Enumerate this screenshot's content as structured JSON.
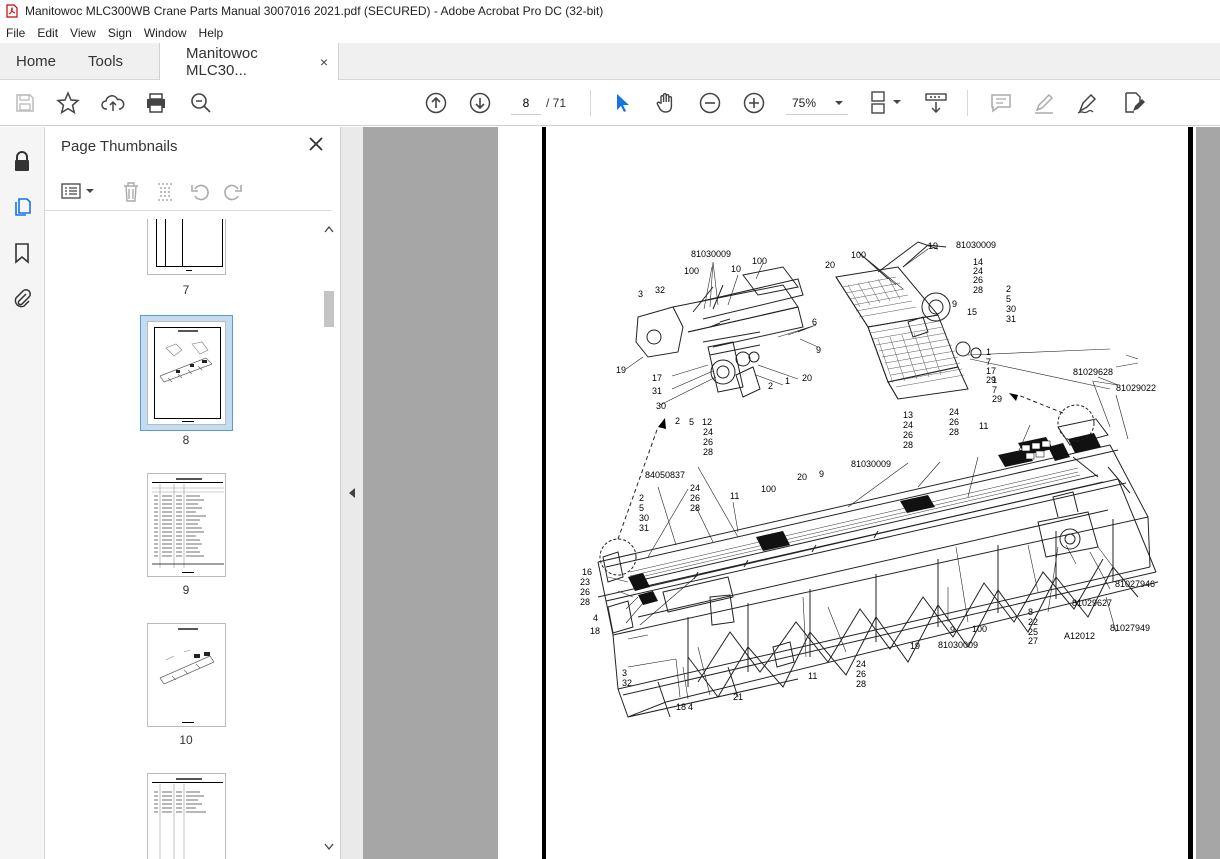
{
  "window": {
    "title": "Manitowoc MLC300WB Crane Parts Manual 3007016 2021.pdf (SECURED) - Adobe Acrobat Pro DC (32-bit)"
  },
  "menu": [
    "File",
    "Edit",
    "View",
    "Sign",
    "Window",
    "Help"
  ],
  "tabs": {
    "home": "Home",
    "tools": "Tools",
    "doc": "Manitowoc MLC30...",
    "doc_close": "×"
  },
  "toolbar": {
    "page_current": "8",
    "page_total": "/ 71",
    "zoom": "75%"
  },
  "panel": {
    "title": "Page Thumbnails"
  },
  "thumbnails": [
    {
      "label": "7"
    },
    {
      "label": "8",
      "selected": true
    },
    {
      "label": "9"
    },
    {
      "label": "10"
    }
  ],
  "callouts": {
    "top_left": [
      "81030009",
      "100",
      "10",
      "100",
      "3",
      "32",
      "6",
      "9",
      "19",
      "17",
      "31",
      "30",
      "2",
      "5",
      "12",
      "24",
      "26",
      "28",
      "2",
      "1",
      "20"
    ],
    "top_right": [
      "100",
      "19",
      "81030009",
      "20",
      "14",
      "24",
      "26",
      "28",
      "2",
      "5",
      "30",
      "31",
      "9",
      "15",
      "1",
      "7",
      "17",
      "29",
      "1",
      "7",
      "29"
    ],
    "main": [
      "13",
      "24",
      "26",
      "28",
      "24",
      "26",
      "28",
      "11",
      "81029628",
      "81029022",
      "81030009",
      "84050837",
      "24",
      "26",
      "28",
      "11",
      "100",
      "20",
      "9",
      "2",
      "5",
      "30",
      "31",
      "16",
      "23",
      "26",
      "28",
      "4",
      "18",
      "3",
      "32",
      "18",
      "4",
      "21",
      "11",
      "24",
      "26",
      "28",
      "19",
      "81030009",
      "9",
      "100",
      "8",
      "22",
      "25",
      "27",
      "A12012",
      "81029627",
      "81027946",
      "81027949"
    ]
  }
}
